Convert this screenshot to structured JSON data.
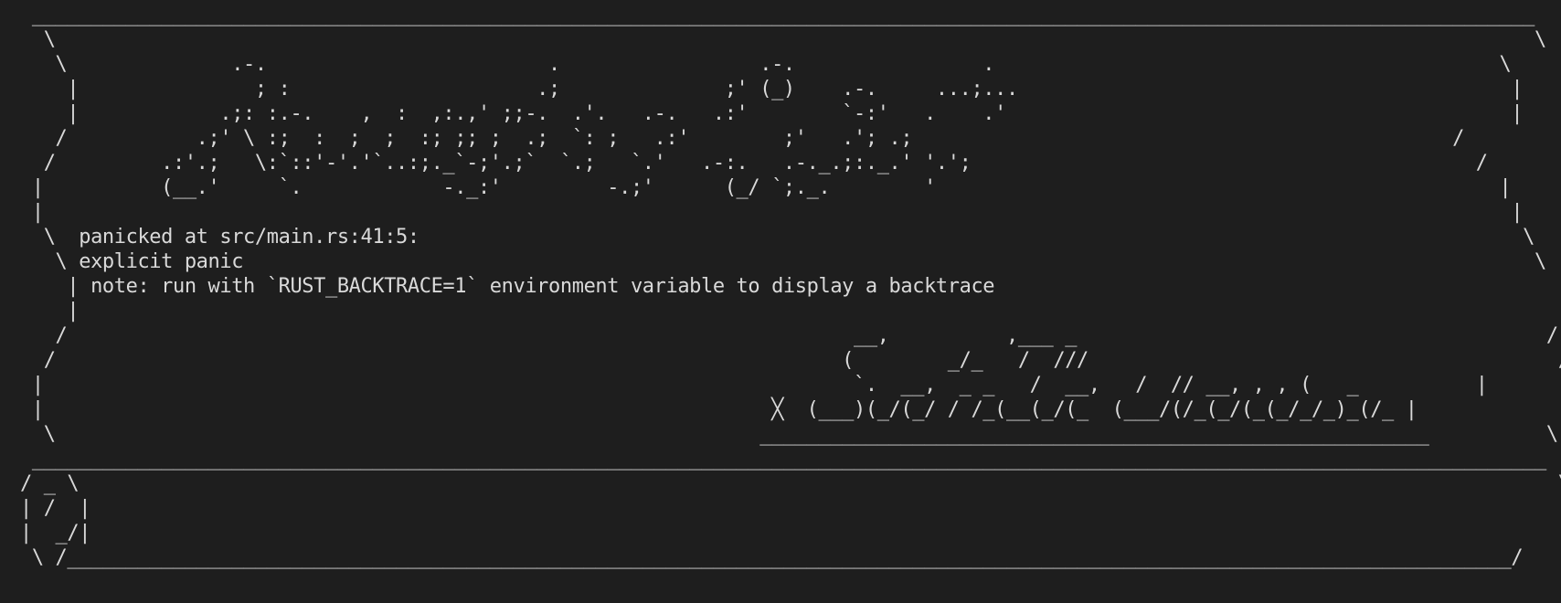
{
  "terminal": {
    "lines": [
      " ________________________________________________________________________________________________________________________________",
      "  \\                                                                                                                              \\",
      "   \\              .-.                        .                 .-.                .                                           \\",
      "    |               ; :                     .;              ;' (_)    .-.     ...;...                                          |",
      "    |            .;: :.-.    ,  :  ,:.,' ;;-.  .'.   .-.   .:'        `-:'   .    .'                                           |",
      "   /           .;' \\ :;  :  ;  ;  :; ;; ;  .;  `: ;   .:'        ;'   .'; .;                                              /",
      "  /         .:'.;   \\:`::'-'.'`..:;._`-;'.;`  `.;   `.'   .-:.   .-._.;:._.' '.';                                           /",
      " |          (__.'     `.            -._:'         -.;'      (_/ `;._.        '                                                |",
      " |                                                                                                                             |",
      "  \\  panicked at src/main.rs:41:5:                                                                                              \\",
      "   \\ explicit panic                                                                                                              \\",
      "    | note: run with `RUST_BACKTRACE=1` environment variable to display a backtrace                                                  |",
      "    |                                                                                                                                |",
      "   /                                                                   __,          ,___ _                                        /",
      "  /                                                                   (        _/_   /  ///                                        /",
      " |                                                                     `.  __,  _ _   /  __,   /  // __, , , (   _          |",
      " |                                                              ╳  (___)(_/(_/ / /_(__(_/(_  (___/(/_(_/(_(_/_/_)_(/_ |",
      "  \\                                                            _________________________________________________________          \\",
      " _________________________________________________________________________________________________________________________________",
      "/ _ \\                                                                                                                              \\",
      "| /  |                                                                                                                              |",
      "|  _/|                                                                                                                              |",
      " \\ /___________________________________________________________________________________________________________________________/"
    ]
  }
}
